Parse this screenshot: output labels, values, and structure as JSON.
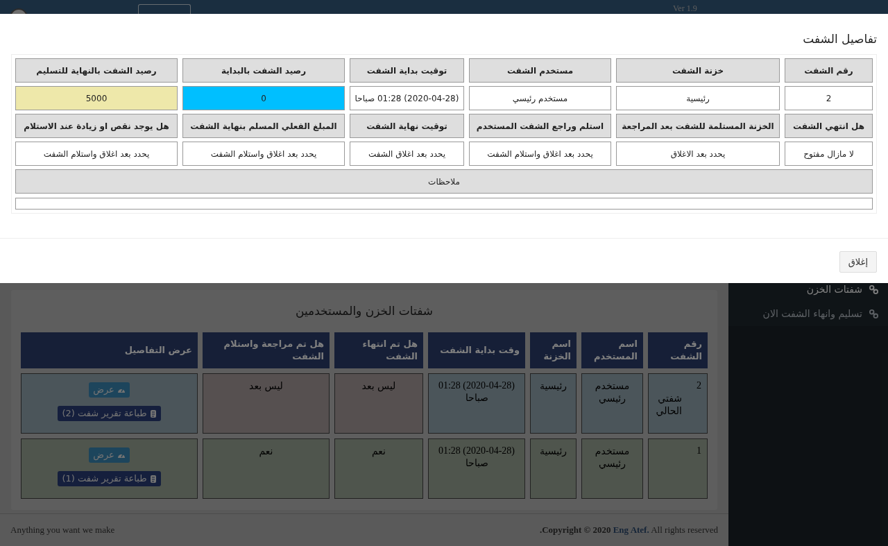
{
  "top_bar": {
    "version": "Ver 1.9"
  },
  "sidebar": {
    "items": [
      {
        "label": "شفتات الخزن",
        "selected": true
      },
      {
        "label": "تسليم وانهاء الشفت الان",
        "selected": false
      }
    ]
  },
  "card": {
    "title": "شفتات الخزن والمستخدمين",
    "columns": [
      "رقم الشفت",
      "اسم المستخدم",
      "اسم الخزنة",
      "وقت بداية الشفت",
      "هل تم انتهاء الشفت",
      "هل تم مراجعة واستلام الشفت",
      "عرض التفاصيل"
    ],
    "rows": [
      {
        "closed": false,
        "number": "2",
        "tag": "شفتي الحالي",
        "user": "مستخدم رئيسي",
        "safe": "رئيسية",
        "start": "(2020-04-28) 01:28 صباحا",
        "ended": "ليس بعد",
        "reviewed": "ليس بعد",
        "view_button": "عرض",
        "print_button": "طباعة تقرير شفت (2)"
      },
      {
        "closed": true,
        "number": "1",
        "user": "مستخدم رئيسي",
        "safe": "رئيسية",
        "start": "(2020-04-28) 01:28 صباحا",
        "ended": "نعم",
        "reviewed": "نعم",
        "view_button": "عرض",
        "print_button": "طباعة تقرير شفت (1)"
      }
    ]
  },
  "footer": {
    "left": "Anything you want we make",
    "copyright": ".Copyright © 2020",
    "author_link": "Eng Atef.",
    "rights": "All rights reserved"
  },
  "modal": {
    "title": "تفاصيل الشفت",
    "fields": [
      {
        "label": "رقم الشفت",
        "value": "2"
      },
      {
        "label": "خزنة الشفت",
        "value": "رئيسية"
      },
      {
        "label": "مستخدم الشفت",
        "value": "مستخدم رئيسي"
      },
      {
        "label": "توقيت بداية الشفت",
        "value": "(2020-04-28) 01:28 صباحا"
      },
      {
        "label": "رصيد الشفت بالبداية",
        "value": "0",
        "color": "#00bfff"
      },
      {
        "label": "رصيد الشفت بالنهاية للتسليم",
        "value": "5000",
        "color": "#eee8aa"
      },
      {
        "label": "هل انتهي الشفت",
        "value": "لا مازال مفتوح"
      },
      {
        "label": "الخزنة المستلمة للشفت بعد المراجعة",
        "value": "يحدد بعد الاغلاق"
      },
      {
        "label": "استلم وراجع الشفت المستخدم",
        "value": "يحدد بعد اغلاق واستلام الشفت"
      },
      {
        "label": "توقيت نهاية الشفت",
        "value": "يحدد بعد اغلاق الشفت"
      },
      {
        "label": "المبلغ الفعلي المسلم بنهاية الشفت",
        "value": "يحدد بعد اغلاق واستلام الشفت"
      },
      {
        "label": "هل يوجد نقص او زيادة عند الاستلام",
        "value": "يحدد بعد اغلاق واستلام الشفت"
      }
    ],
    "notes_label": "ملاحظات",
    "close_button": "إغلاق"
  }
}
